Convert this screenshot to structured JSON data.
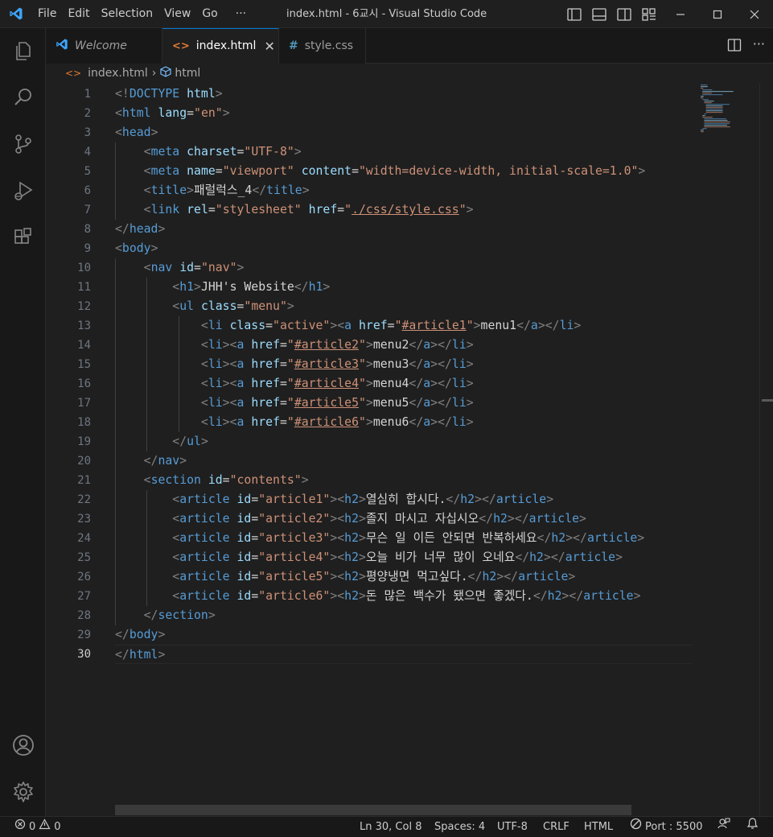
{
  "window": {
    "title": "index.html - 6교시 - Visual Studio Code"
  },
  "menu": [
    "File",
    "Edit",
    "Selection",
    "View",
    "Go",
    "···"
  ],
  "tabs": [
    {
      "label": "Welcome",
      "icon": "vscode-logo-icon"
    },
    {
      "label": "index.html",
      "icon": "html-file-icon",
      "close": "✕"
    },
    {
      "label": "style.css",
      "icon": "css-file-icon"
    }
  ],
  "breadcrumb": {
    "file": "index.html",
    "symbol": "html",
    "separator": "›"
  },
  "editor": {
    "current_line": 30,
    "lines": [
      "<!DOCTYPE html>",
      "<html lang=\"en\">",
      "<head>",
      "    <meta charset=\"UTF-8\">",
      "    <meta name=\"viewport\" content=\"width=device-width, initial-scale=1.0\">",
      "    <title>패럴럭스_4</title>",
      "    <link rel=\"stylesheet\" href=\"./css/style.css\">",
      "</head>",
      "<body>",
      "    <nav id=\"nav\">",
      "        <h1>JHH's Website</h1>",
      "        <ul class=\"menu\">",
      "            <li class=\"active\"><a href=\"#article1\">menu1</a></li>",
      "            <li><a href=\"#article2\">menu2</a></li>",
      "            <li><a href=\"#article3\">menu3</a></li>",
      "            <li><a href=\"#article4\">menu4</a></li>",
      "            <li><a href=\"#article5\">menu5</a></li>",
      "            <li><a href=\"#article6\">menu6</a></li>",
      "        </ul>",
      "    </nav>",
      "    <section id=\"contents\">",
      "        <article id=\"article1\"><h2>열심히 합시다.</h2></article>",
      "        <article id=\"article2\"><h2>졸지 마시고 자십시오</h2></article>",
      "        <article id=\"article3\"><h2>무슨 일 이든 안되면 반복하세요</h2></article>",
      "        <article id=\"article4\"><h2>오늘 비가 너무 많이 오네요</h2></article>",
      "        <article id=\"article5\"><h2>평양냉면 먹고싶다.</h2></article>",
      "        <article id=\"article6\"><h2>돈 많은 백수가 됐으면 좋겠다.</h2></article>",
      "    </section>",
      "</body>",
      "</html>"
    ]
  },
  "status": {
    "errors": "0",
    "warnings": "0",
    "position": "Ln 30, Col 8",
    "spaces": "Spaces: 4",
    "encoding": "UTF-8",
    "eol": "CRLF",
    "language": "HTML",
    "port": "Port : 5500"
  },
  "colors": {
    "tag": "#569cd6",
    "attribute": "#9cdcfe",
    "string": "#ce9178",
    "bracket": "#808080",
    "text": "#d4d4d4",
    "accent": "#0078d4"
  }
}
